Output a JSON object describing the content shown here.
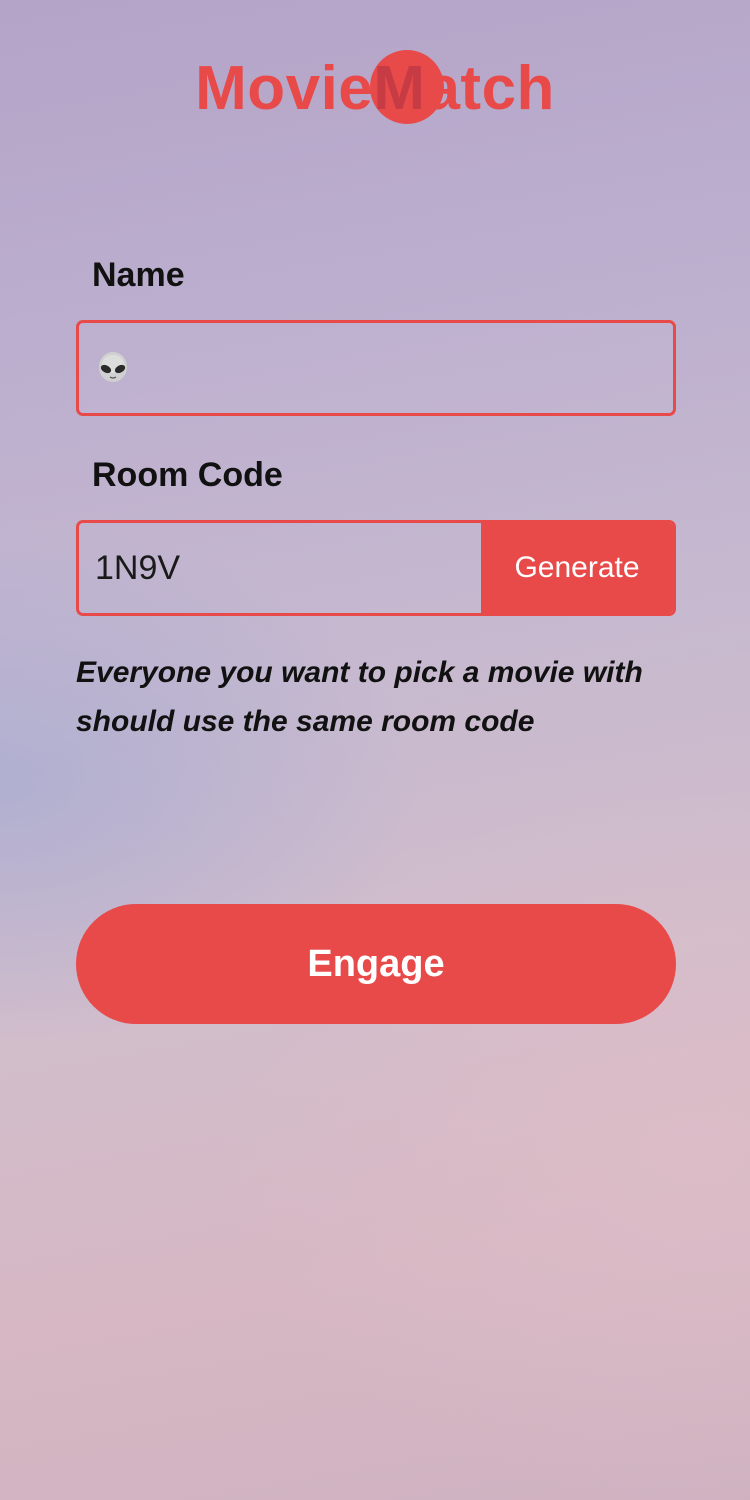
{
  "app": {
    "logo_text_before": "Movie",
    "logo_text_m": "M",
    "logo_text_after": "atch"
  },
  "form": {
    "name_label": "Name",
    "name_value_icon": "alien-icon",
    "room_label": "Room Code",
    "room_value": "1N9V",
    "generate_label": "Generate",
    "hint": "Everyone you want to pick a movie with should use the same room code",
    "engage_label": "Engage"
  },
  "colors": {
    "accent": "#e84a4a"
  }
}
